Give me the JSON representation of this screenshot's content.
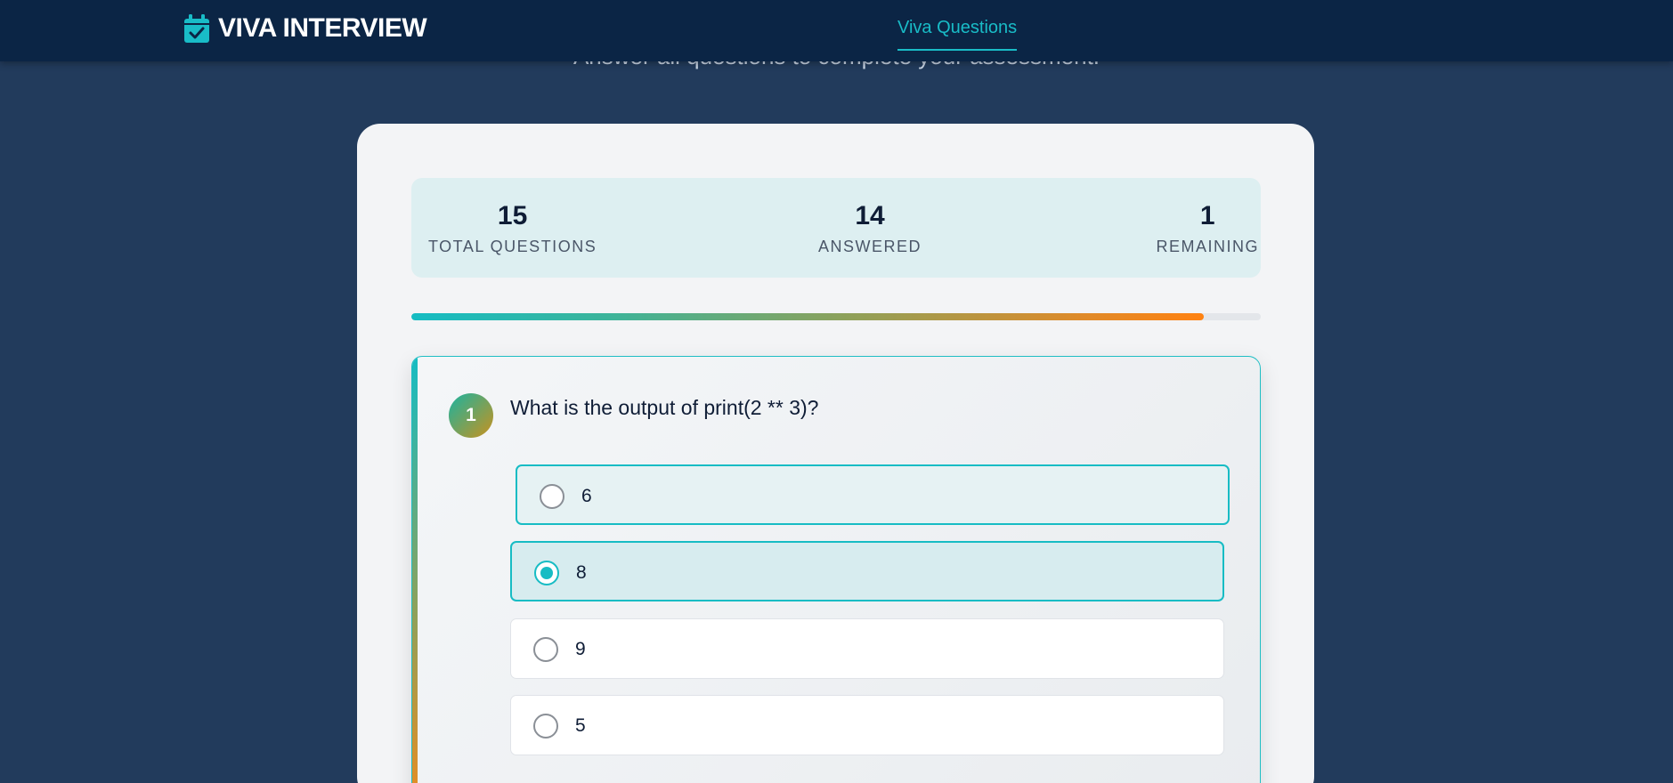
{
  "header": {
    "brand_title": "VIVA INTERVIEW",
    "brand_icon": "calendar-check-icon",
    "nav_link": "Viva Questions"
  },
  "page": {
    "subtitle": "Answer all questions to complete your assessment."
  },
  "stats": {
    "total_value": "15",
    "total_label": "TOTAL QUESTIONS",
    "answered_value": "14",
    "answered_label": "ANSWERED",
    "remaining_value": "1",
    "remaining_label": "REMAINING"
  },
  "progress": {
    "percent": 93.3
  },
  "question": {
    "number": "1",
    "text": "What is the output of print(2 ** 3)?",
    "options": [
      {
        "label": "6",
        "state": "hover"
      },
      {
        "label": "8",
        "state": "selected"
      },
      {
        "label": "9",
        "state": "default"
      },
      {
        "label": "5",
        "state": "default"
      }
    ]
  },
  "colors": {
    "nav_bg": "#0b2545",
    "page_bg": "#223b5c",
    "accent": "#19bcc7",
    "progress_end": "#ff8212"
  }
}
